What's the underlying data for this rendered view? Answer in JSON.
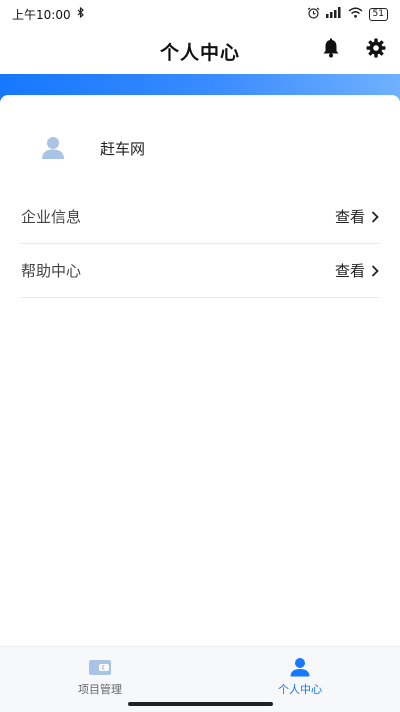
{
  "status_bar": {
    "time": "上午10:00",
    "battery": "51"
  },
  "header": {
    "title": "个人中心",
    "icons": [
      "bell-icon",
      "gear-icon"
    ]
  },
  "profile": {
    "company_name": "赶车网",
    "avatar_icon": "user-avatar-icon"
  },
  "menu": {
    "items": [
      {
        "label": "企业信息",
        "action": "查看"
      },
      {
        "label": "帮助中心",
        "action": "查看"
      }
    ]
  },
  "tab_bar": {
    "tabs": [
      {
        "label": "项目管理",
        "icon": "wallet-icon",
        "active": false
      },
      {
        "label": "个人中心",
        "icon": "user-icon",
        "active": true
      }
    ]
  },
  "colors": {
    "accent": "#1677ff",
    "inactive_icon": "#a9c3e6"
  }
}
